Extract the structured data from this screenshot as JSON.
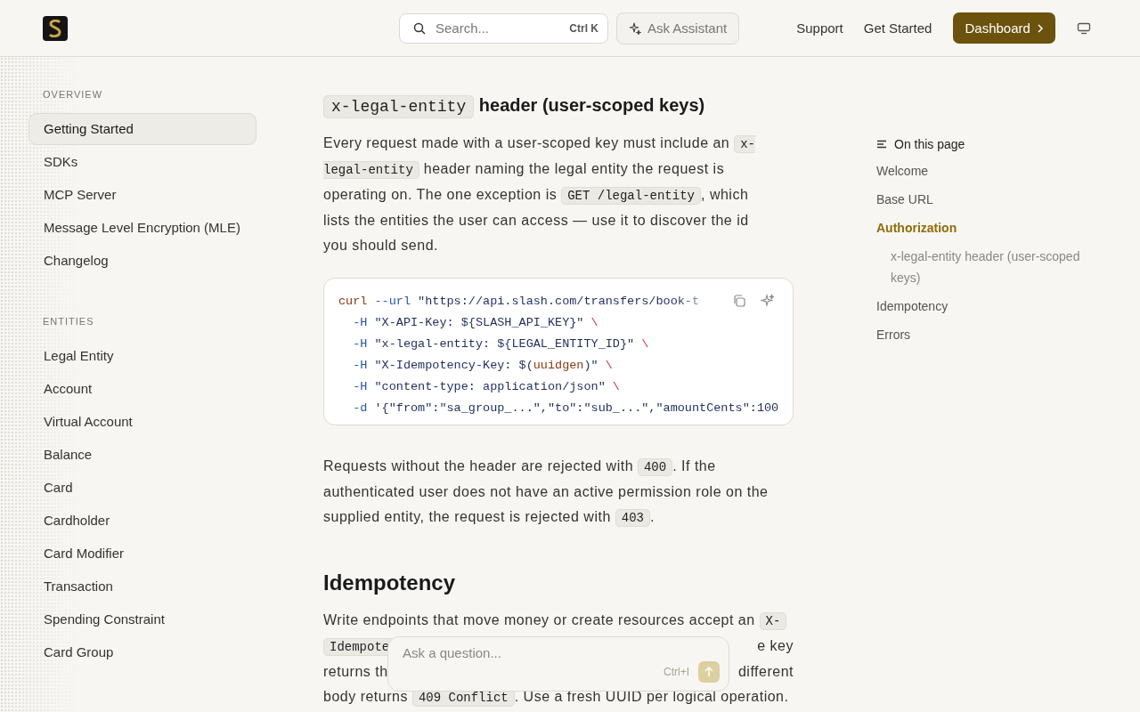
{
  "header": {
    "search": {
      "placeholder": "Search...",
      "shortcut": "Ctrl K"
    },
    "assistant": "Ask Assistant",
    "links": [
      "Support",
      "Get Started"
    ],
    "dashboard": "Dashboard"
  },
  "sidebar": {
    "groups": [
      {
        "title": "OVERVIEW",
        "items": [
          {
            "label": "Getting Started",
            "selected": true
          },
          {
            "label": "SDKs",
            "selected": false
          },
          {
            "label": "MCP Server",
            "selected": false
          },
          {
            "label": "Message Level Encryption (MLE)",
            "selected": false
          },
          {
            "label": "Changelog",
            "selected": false
          }
        ]
      },
      {
        "title": "ENTITIES",
        "items": [
          {
            "label": "Legal Entity",
            "selected": false
          },
          {
            "label": "Account",
            "selected": false
          },
          {
            "label": "Virtual Account",
            "selected": false
          },
          {
            "label": "Balance",
            "selected": false
          },
          {
            "label": "Card",
            "selected": false
          },
          {
            "label": "Cardholder",
            "selected": false
          },
          {
            "label": "Card Modifier",
            "selected": false
          },
          {
            "label": "Transaction",
            "selected": false
          },
          {
            "label": "Spending Constraint",
            "selected": false
          },
          {
            "label": "Card Group",
            "selected": false
          }
        ]
      }
    ]
  },
  "content": [
    {
      "kind": "h3",
      "parts": [
        {
          "kind": "code",
          "text": "x-legal-entity"
        },
        {
          "kind": "text",
          "text": " header (user-scoped keys)"
        }
      ]
    },
    {
      "kind": "p",
      "parts": [
        {
          "kind": "text",
          "text": "Every request made with a user-scoped key must include an "
        },
        {
          "kind": "code",
          "text": "x-legal-entity"
        },
        {
          "kind": "text",
          "text": " header naming the legal entity the request is operating on. The one exception is "
        },
        {
          "kind": "code",
          "text": "GET /legal-entity"
        },
        {
          "kind": "text",
          "text": ", which lists the entities the user can access — use it to discover the id you should send."
        }
      ]
    },
    {
      "kind": "codeblock",
      "lines": [
        [
          {
            "kind": "cmd",
            "text": "curl"
          },
          {
            "kind": "flag",
            "text": " --url"
          },
          {
            "kind": "str",
            "text": " \"https://api.slash.com/transfers/book-t"
          }
        ],
        [
          {
            "kind": "flag",
            "text": "  -H"
          },
          {
            "kind": "str",
            "text": " \"X-API-Key: ${SLASH_API_KEY}\""
          },
          {
            "kind": "esc",
            "text": " \\"
          }
        ],
        [
          {
            "kind": "flag",
            "text": "  -H"
          },
          {
            "kind": "str",
            "text": " \"x-legal-entity: ${LEGAL_ENTITY_ID}\""
          },
          {
            "kind": "esc",
            "text": " \\"
          }
        ],
        [
          {
            "kind": "flag",
            "text": "  -H"
          },
          {
            "kind": "str",
            "text": " \"X-Idempotency-Key: $("
          },
          {
            "kind": "cmd",
            "text": "uuidgen"
          },
          {
            "kind": "str",
            "text": ")\""
          },
          {
            "kind": "esc",
            "text": " \\"
          }
        ],
        [
          {
            "kind": "flag",
            "text": "  -H"
          },
          {
            "kind": "str",
            "text": " \"content-type: application/json\""
          },
          {
            "kind": "esc",
            "text": " \\"
          }
        ],
        [
          {
            "kind": "flag",
            "text": "  -d"
          },
          {
            "kind": "str",
            "text": " '{\"from\":\"sa_group_...\",\"to\":\"sub_...\",\"amountCents\":100"
          }
        ]
      ]
    },
    {
      "kind": "p",
      "parts": [
        {
          "kind": "text",
          "text": "Requests without the header are rejected with "
        },
        {
          "kind": "code",
          "text": "400"
        },
        {
          "kind": "text",
          "text": ". If the authenticated user does not have an active permission role on the supplied entity, the request is rejected with "
        },
        {
          "kind": "code",
          "text": "403"
        },
        {
          "kind": "text",
          "text": "."
        }
      ]
    },
    {
      "kind": "h2",
      "parts": [
        {
          "kind": "text",
          "text": "Idempotency"
        }
      ]
    },
    {
      "kind": "lines",
      "lines": [
        {
          "left": [
            {
              "kind": "text",
              "text": "Write endpoints that move money or create resources accept an "
            },
            {
              "kind": "code",
              "text": "X-"
            }
          ]
        },
        {
          "left": [
            {
              "kind": "code",
              "text": "Idempote"
            }
          ],
          "right": [
            {
              "kind": "text",
              "text": "e key"
            }
          ]
        },
        {
          "left": [
            {
              "kind": "text",
              "text": "returns th"
            }
          ],
          "right": [
            {
              "kind": "text",
              "text": "different"
            }
          ]
        },
        {
          "left": [
            {
              "kind": "text",
              "text": "body returns "
            },
            {
              "kind": "code",
              "text": "409 Conflict"
            },
            {
              "kind": "text",
              "text": ". Use a fresh UUID per logical operation."
            }
          ]
        }
      ]
    }
  ],
  "toc": {
    "title": "On this page",
    "items": [
      {
        "label": "Welcome",
        "selected": false
      },
      {
        "label": "Base URL",
        "selected": false
      },
      {
        "label": "Authorization",
        "selected": true,
        "children": [
          {
            "label": "x-legal-entity header (user-scoped keys)",
            "selected": false
          }
        ]
      },
      {
        "label": "Idempotency",
        "selected": false
      },
      {
        "label": "Errors",
        "selected": false
      }
    ]
  },
  "ask": {
    "placeholder": "Ask a question...",
    "shortcut": "Ctrl+I"
  }
}
